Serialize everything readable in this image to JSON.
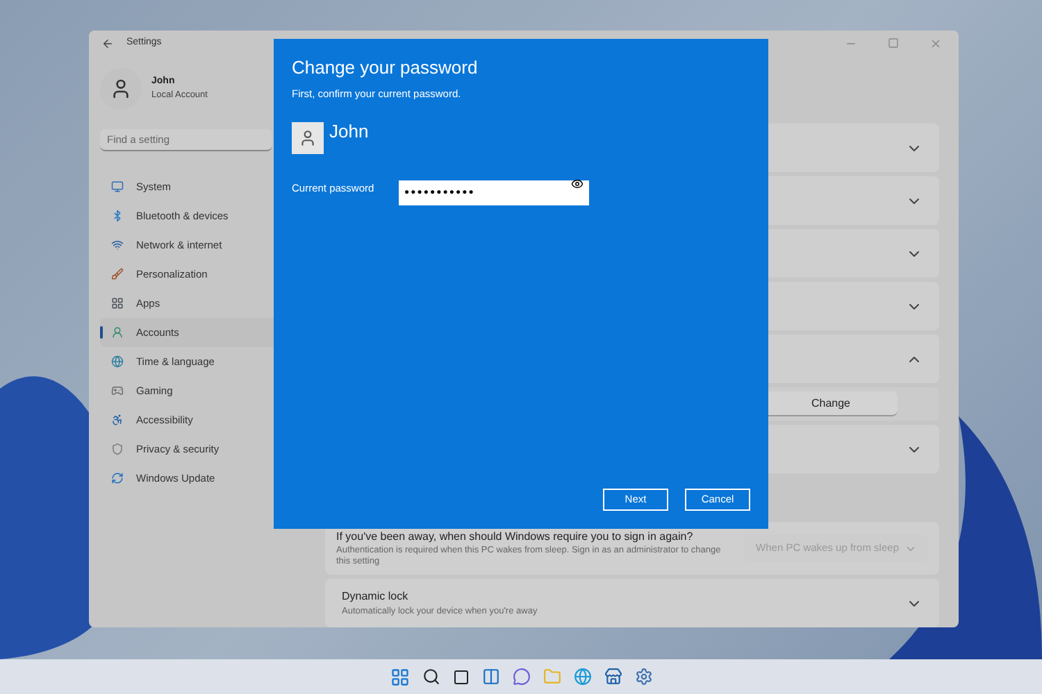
{
  "settings_window": {
    "title": "Settings",
    "account": {
      "name": "John",
      "type": "Local Account"
    },
    "search": {
      "placeholder": "Find a setting"
    },
    "nav_items": [
      {
        "label": "System",
        "selected": false,
        "color": "#2f6fb5"
      },
      {
        "label": "Bluetooth & devices",
        "selected": false,
        "color": "#1e73c8"
      },
      {
        "label": "Network & internet",
        "selected": false,
        "color": "#2a5f9e"
      },
      {
        "label": "Personalization",
        "selected": false,
        "color": "#a0522d"
      },
      {
        "label": "Apps",
        "selected": false,
        "color": "#4a4f5a"
      },
      {
        "label": "Accounts",
        "selected": true,
        "color": "#2e8b6e"
      },
      {
        "label": "Time & language",
        "selected": false,
        "color": "#2e7fa0"
      },
      {
        "label": "Gaming",
        "selected": false,
        "color": "#6b6b6b"
      },
      {
        "label": "Accessibility",
        "selected": false,
        "color": "#1f5fa8"
      },
      {
        "label": "Privacy & security",
        "selected": false,
        "color": "#7a7a7a"
      },
      {
        "label": "Windows Update",
        "selected": false,
        "color": "#1e6fc0"
      }
    ],
    "rows": [
      {
        "kind": "collapsible",
        "expanded": false
      },
      {
        "kind": "collapsible",
        "expanded": false
      },
      {
        "kind": "collapsible",
        "expanded": false
      },
      {
        "kind": "collapsible",
        "expanded": false
      },
      {
        "kind": "collapsible",
        "expanded": true,
        "button": "Change"
      },
      {
        "kind": "collapsible",
        "expanded": false
      },
      {
        "kind": "dropdown",
        "title": "If you've been away, when should Windows require you to sign in again?",
        "description": "Authentication is required when this PC wakes from sleep. Sign in as an administrator to change this setting",
        "value": "When PC wakes up from sleep",
        "disabled": true
      },
      {
        "kind": "collapsible",
        "expanded": false,
        "title": "Dynamic lock",
        "description": "Automatically lock your device when you're away"
      }
    ]
  },
  "dialog": {
    "title": "Change your password",
    "subtitle": "First, confirm your current password.",
    "user": "John",
    "field": {
      "label": "Current password",
      "value": "●●●●●●●●●●●"
    },
    "buttons": [
      "Next",
      "Cancel"
    ]
  }
}
